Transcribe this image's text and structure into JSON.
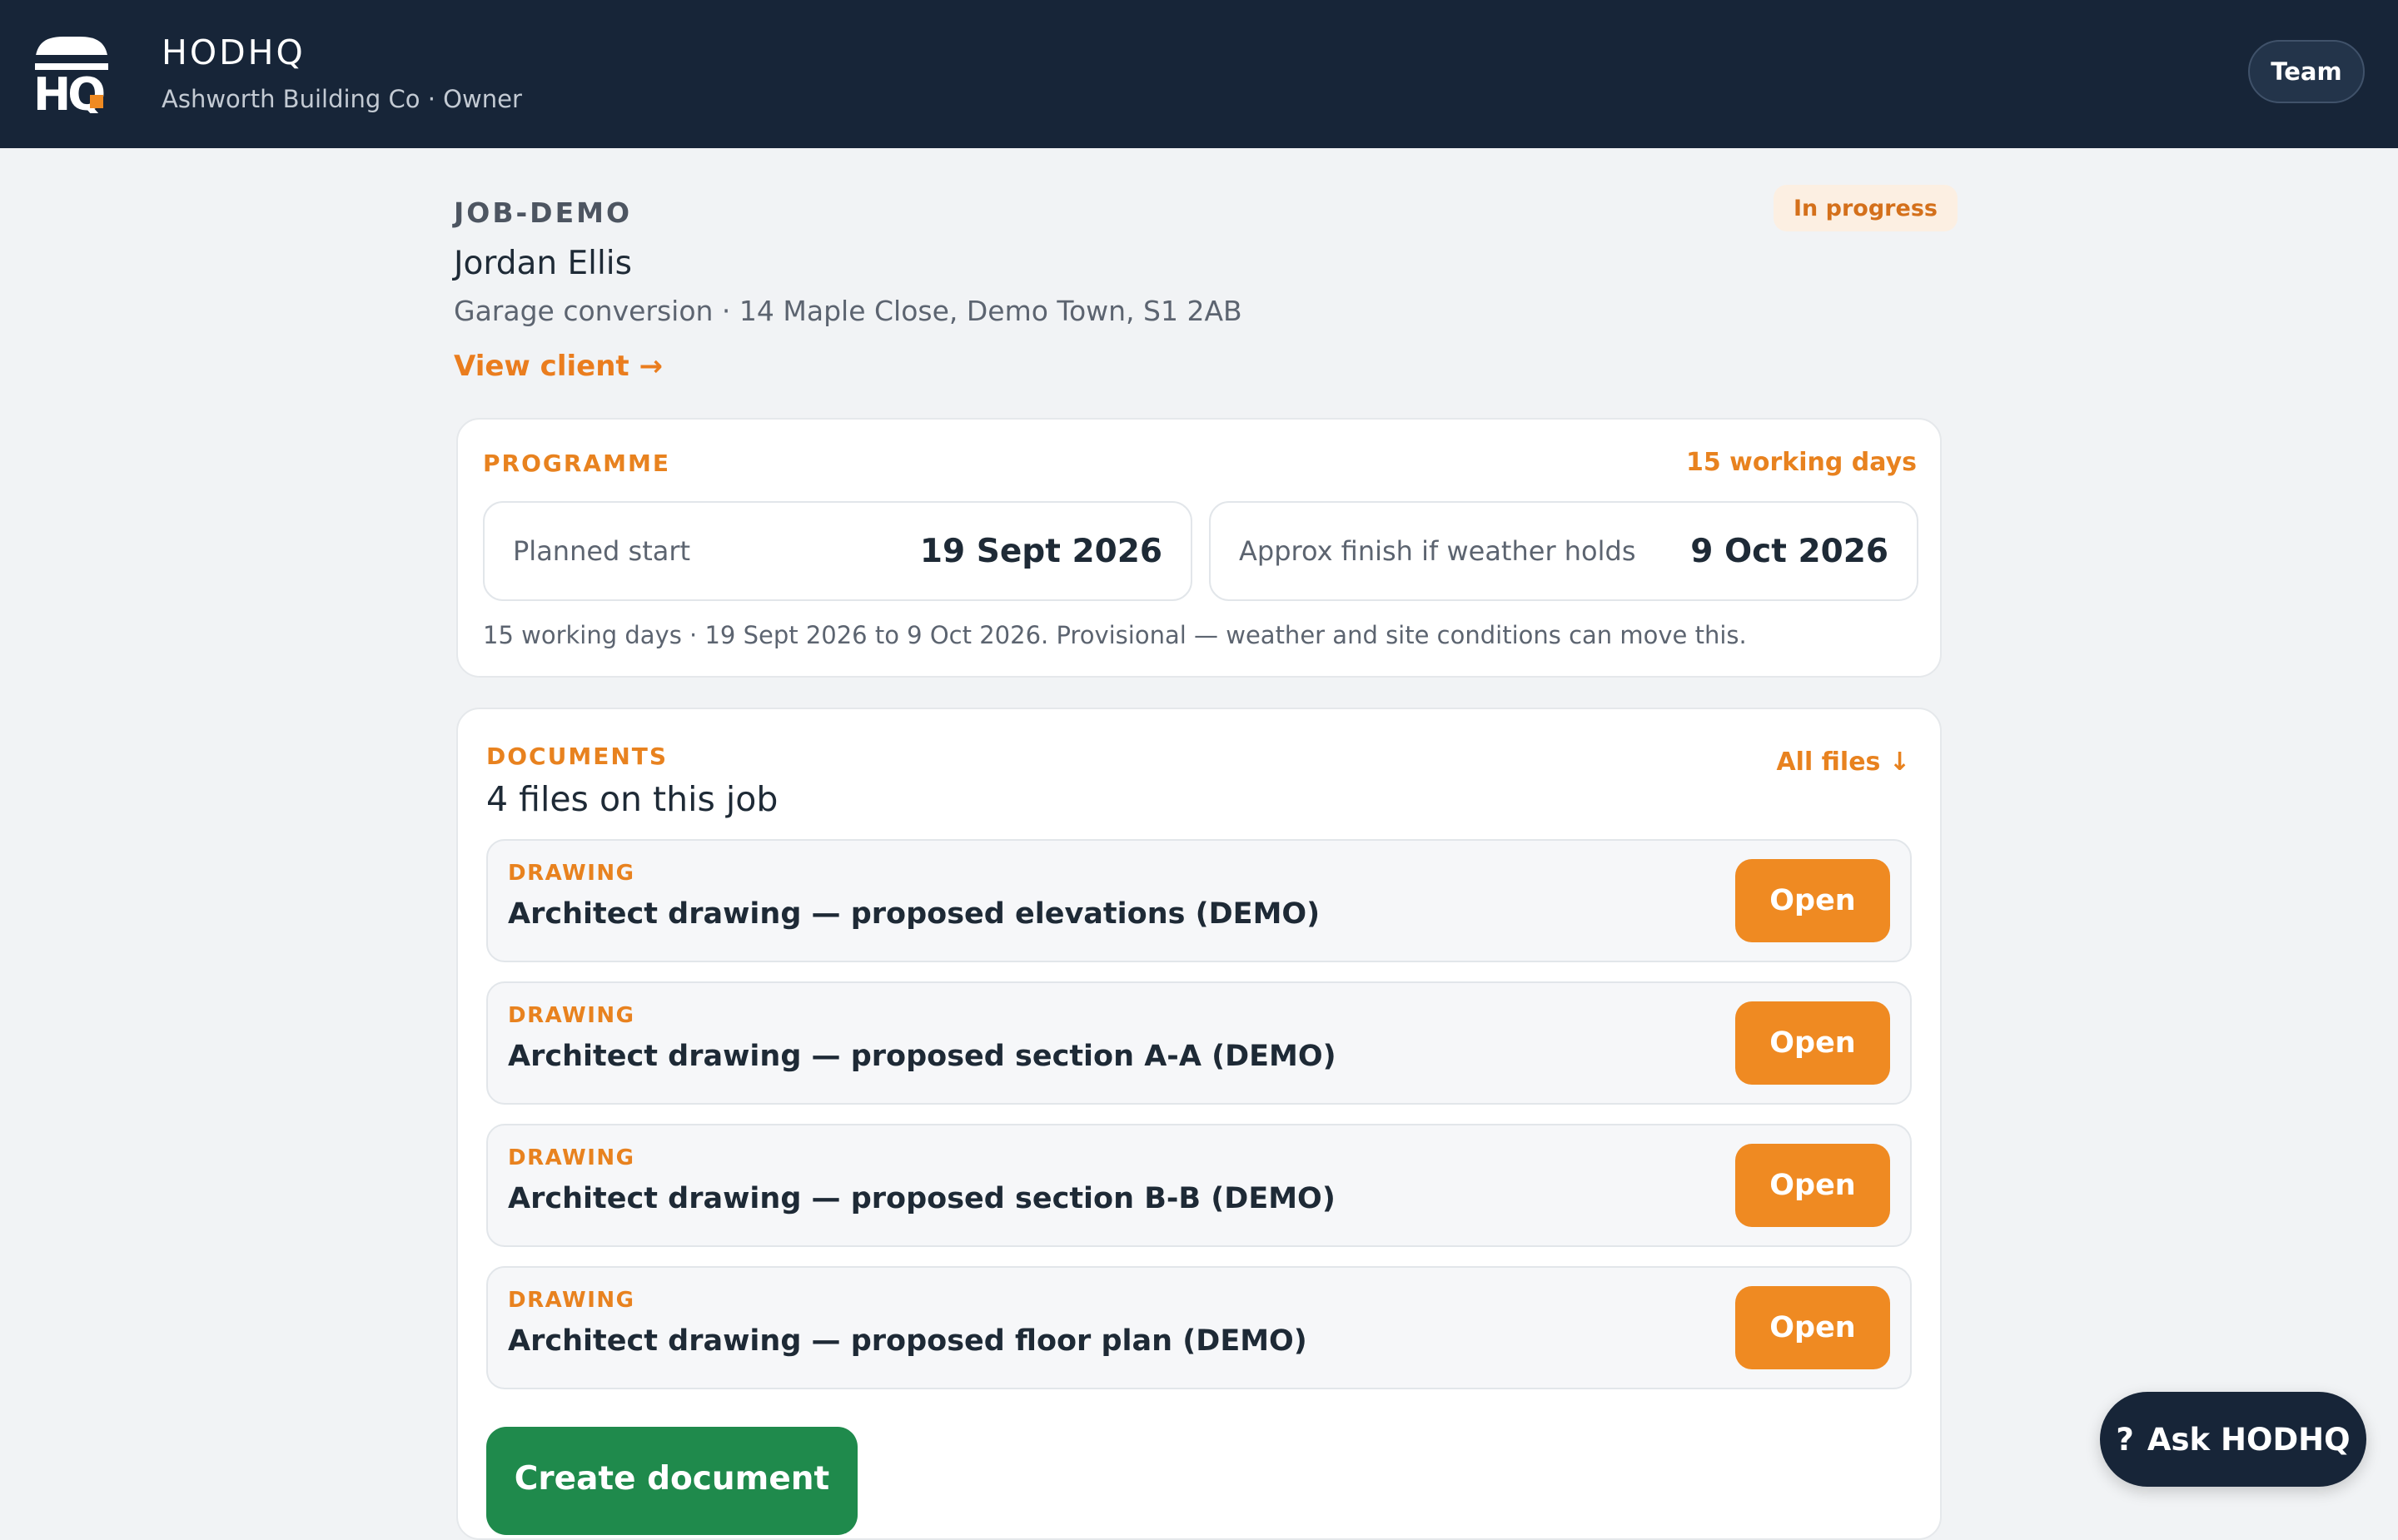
{
  "header": {
    "brand": "HODHQ",
    "logo_text": "HQ",
    "subtitle": "Ashworth Building Co · Owner",
    "team_label": "Team"
  },
  "job": {
    "code": "JOB-DEMO",
    "status": "In progress",
    "client_name": "Jordan Ellis",
    "description": "Garage conversion · 14 Maple Close, Demo Town, S1 2AB",
    "view_client_label": "View client →"
  },
  "programme": {
    "label": "PROGRAMME",
    "duration": "15 working days",
    "start_label": "Planned start",
    "start_value": "19 Sept 2026",
    "finish_label": "Approx finish if weather holds",
    "finish_value": "9 Oct 2026",
    "note": "15 working days · 19 Sept 2026 to 9 Oct 2026. Provisional — weather and site conditions can move this."
  },
  "documents": {
    "label": "DOCUMENTS",
    "count_text": "4 files on this job",
    "all_files_label": "All files ↓",
    "items": [
      {
        "type": "DRAWING",
        "title": "Architect drawing — proposed elevations (DEMO)",
        "action": "Open"
      },
      {
        "type": "DRAWING",
        "title": "Architect drawing — proposed section A-A (DEMO)",
        "action": "Open"
      },
      {
        "type": "DRAWING",
        "title": "Architect drawing — proposed section B-B (DEMO)",
        "action": "Open"
      },
      {
        "type": "DRAWING",
        "title": "Architect drawing — proposed floor plan (DEMO)",
        "action": "Open"
      }
    ],
    "create_label": "Create document"
  },
  "assistant": {
    "icon": "?",
    "label": "Ask HODHQ"
  },
  "colors": {
    "topbar": "#172538",
    "accent": "#ef8a22",
    "create": "#1f8a4c",
    "status_bg": "#fcefe2"
  }
}
